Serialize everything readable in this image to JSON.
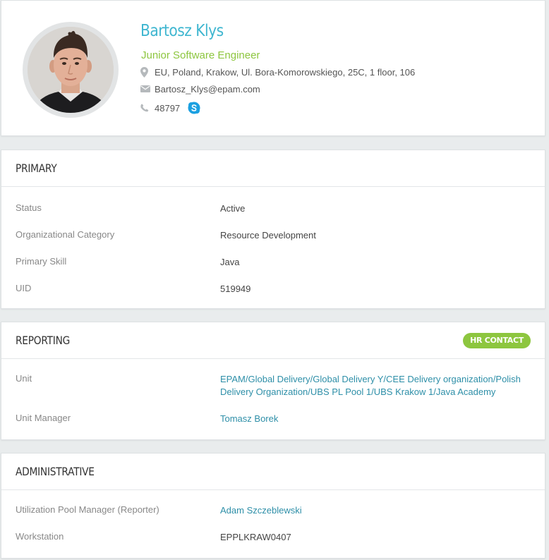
{
  "profile": {
    "name": "Bartosz Klys",
    "title": "Junior Software Engineer",
    "location": "EU, Poland, Krakow, Ul. Bora-Komorowskiego, 25C, 1 floor, 106",
    "email": "Bartosz_Klys@epam.com",
    "phone": "48797",
    "icons": {
      "location": "map-pin-icon",
      "email": "envelope-icon",
      "phone": "phone-icon",
      "skype": "skype-icon"
    }
  },
  "primary": {
    "title": "PRIMARY",
    "rows": [
      {
        "label": "Status",
        "value": "Active"
      },
      {
        "label": "Organizational Category",
        "value": "Resource Development"
      },
      {
        "label": "Primary Skill",
        "value": "Java"
      },
      {
        "label": "UID",
        "value": "519949"
      }
    ]
  },
  "reporting": {
    "title": "REPORTING",
    "badge": "HR CONTACT",
    "rows": [
      {
        "label": "Unit",
        "value": "EPAM/Global Delivery/Global Delivery Y/CEE Delivery organization/Polish Delivery Organization/UBS PL Pool 1/UBS Krakow 1/Java Academy"
      },
      {
        "label": "Unit Manager",
        "value": "Tomasz Borek"
      }
    ]
  },
  "administrative": {
    "title": "ADMINISTRATIVE",
    "rows": [
      {
        "label": "Utilization Pool Manager (Reporter)",
        "value": "Adam Szczeblewski"
      },
      {
        "label": "Workstation",
        "value": "EPPLKRAW0407"
      }
    ]
  },
  "colors": {
    "name": "#3fb6d0",
    "job_title": "#8dc63f",
    "link": "#2e8fa8",
    "badge": "#8dc63f",
    "background": "#e9eced"
  }
}
